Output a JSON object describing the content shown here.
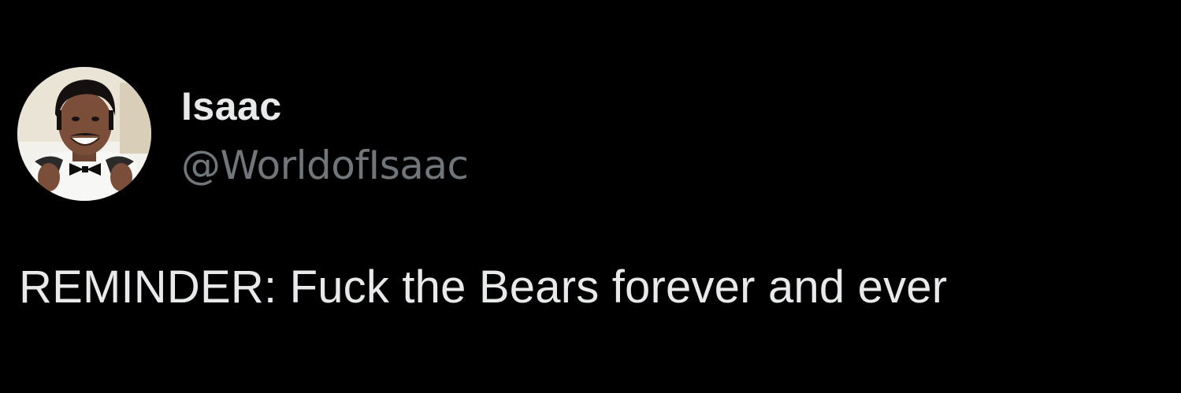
{
  "tweet": {
    "author": {
      "display_name": "Isaac",
      "handle": "@WorldofIsaac",
      "avatar_icon": "profile-photo-avatar"
    },
    "text": "REMINDER: Fuck the Bears forever and ever"
  },
  "colors": {
    "background": "#000000",
    "primary_text": "#e7e9ea",
    "secondary_text": "#71767b"
  }
}
